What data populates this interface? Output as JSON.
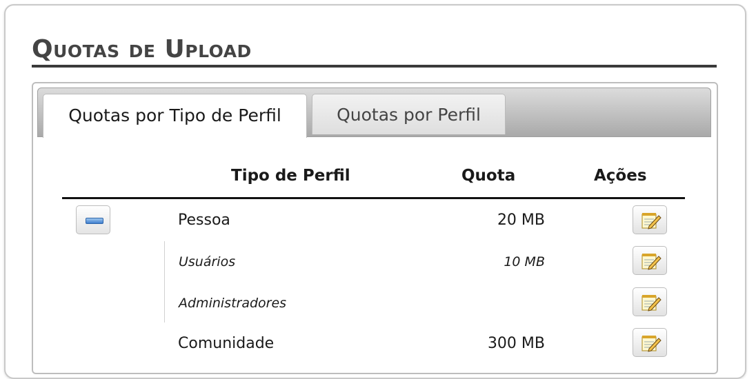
{
  "page": {
    "title": "Quotas de Upload"
  },
  "tabs": [
    {
      "label": "Quotas por Tipo de Perfil",
      "active": true
    },
    {
      "label": "Quotas por Perfil",
      "active": false
    }
  ],
  "table": {
    "headers": {
      "type": "Tipo de Perfil",
      "quota": "Quota",
      "actions": "Ações"
    },
    "rows": [
      {
        "name": "Pessoa",
        "quota": "20 MB",
        "level": "parent",
        "expanded": true,
        "action_icon": "edit-icon"
      },
      {
        "name": "Usuários",
        "quota": "10 MB",
        "level": "child",
        "action_icon": "edit-icon"
      },
      {
        "name": "Administradores",
        "quota": "",
        "level": "child",
        "action_icon": "edit-icon"
      },
      {
        "name": "Comunidade",
        "quota": "300 MB",
        "level": "parent",
        "action_icon": "edit-icon"
      }
    ]
  },
  "icons": {
    "collapse": "minus-icon",
    "edit": "edit-icon"
  }
}
